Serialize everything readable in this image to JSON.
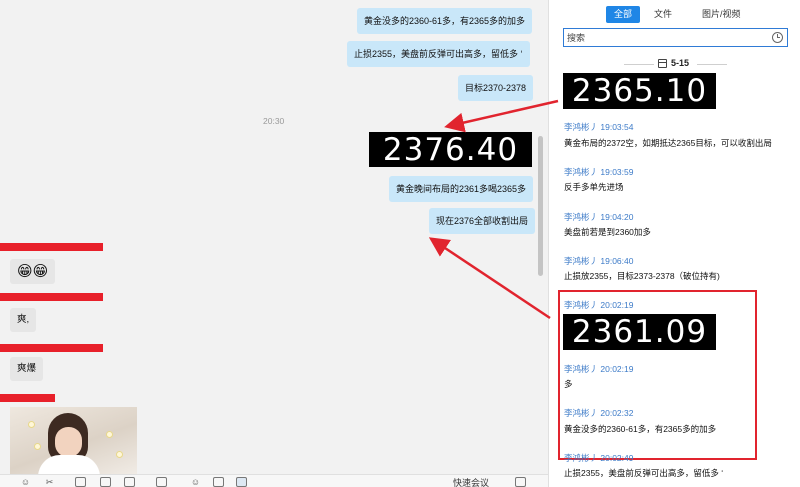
{
  "chat": {
    "outgoing": [
      {
        "text": "黄金没多的2360-61多，有2365多的加多"
      },
      {
        "text": "止损2355，美盘前反弹可出高多，留低多 ‘"
      },
      {
        "text": "目标2370-2378"
      },
      {
        "text": "黄金晚间布局的2361多喝2365多"
      },
      {
        "text": "现在2376全部收割出局"
      }
    ],
    "time_separator": "20:30",
    "ticker_image_value": "2376.40",
    "incoming": [
      {
        "text": "😁😁"
      },
      {
        "text": "爽,"
      },
      {
        "text": "爽爆"
      }
    ],
    "toolbar": {
      "quick_meeting_label": "快速会议"
    }
  },
  "side_panel": {
    "tabs": [
      {
        "label": "全部",
        "active": true
      },
      {
        "label": "文件",
        "active": false
      },
      {
        "label": "图片/视频",
        "active": false
      }
    ],
    "search": {
      "placeholder": "搜索"
    },
    "date_header": "5-15",
    "top_ticker_value": "2365.10",
    "messages": [
      {
        "sender": "李鸿彬丿",
        "time": "19:03:54",
        "text": "黄金布局的2372空，如期抵达2365目标，可以收割出局"
      },
      {
        "sender": "李鸿彬丿",
        "time": "19:03:59",
        "text": "反手多单先进场"
      },
      {
        "sender": "李鸿彬丿",
        "time": "19:04:20",
        "text": "美盘前若是到2360加多"
      },
      {
        "sender": "李鸿彬丿",
        "time": "19:06:40",
        "text": "止损放2355，目标2373-2378（破位持有)"
      },
      {
        "sender": "李鸿彬丿",
        "time": "20:02:19",
        "text": ""
      },
      {
        "sender": "李鸿彬丿",
        "time": "20:02:19",
        "text": "多"
      },
      {
        "sender": "李鸿彬丿",
        "time": "20:02:32",
        "text": "黄金没多的2360-61多，有2365多的加多"
      },
      {
        "sender": "李鸿彬丿",
        "time": "20:02:49",
        "text": "止损2355，美盘前反弹可出高多，留低多 ‘"
      }
    ],
    "highlight_ticker_value": "2361.09"
  },
  "colors": {
    "accent": "#1f86e6",
    "bubble_out": "#c9e7f9",
    "highlight": "#e1242e",
    "sender": "#3d7bc8"
  }
}
